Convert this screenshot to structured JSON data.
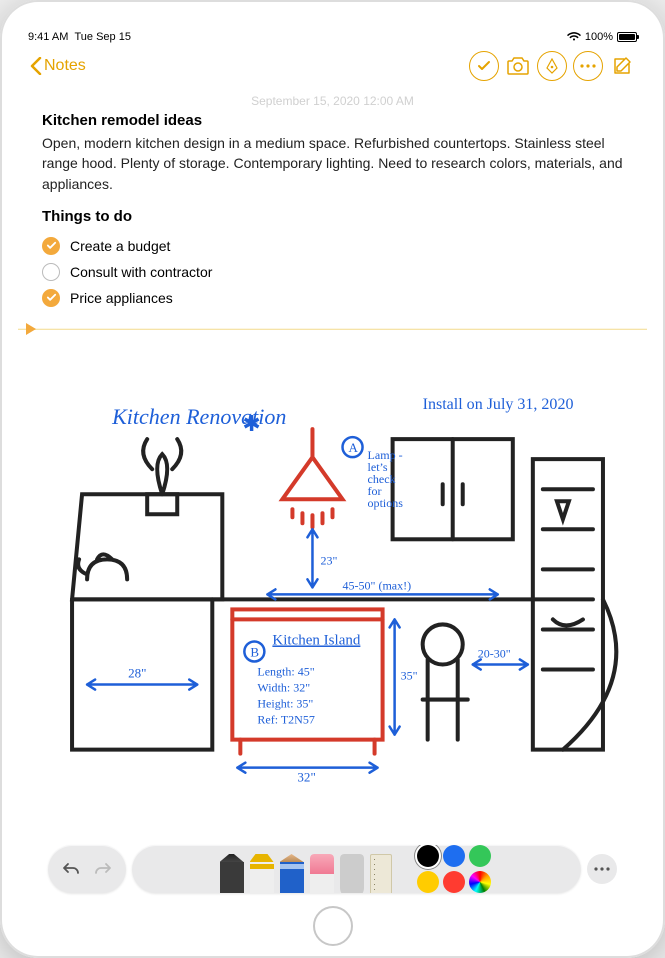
{
  "status": {
    "time": "9:41 AM",
    "date": "Tue Sep 15",
    "battery": "100%"
  },
  "nav": {
    "back_label": "Notes"
  },
  "note": {
    "timestamp": "September 15, 2020 12:00 AM",
    "title": "Kitchen remodel ideas",
    "body": "Open, modern kitchen design in a medium space. Refurbished countertops. Stainless steel range hood. Plenty of storage. Contemporary lighting. Need to research colors, materials, and appliances.",
    "section_title": "Things to do",
    "checklist": [
      {
        "label": "Create a budget",
        "checked": true
      },
      {
        "label": "Consult with contractor",
        "checked": false
      },
      {
        "label": "Price appliances",
        "checked": true
      }
    ]
  },
  "sketch": {
    "title": "Kitchen Renovation",
    "install_note": "Install on July 31, 2020",
    "annotation_a": "Lamp - let’s check for options",
    "island_heading": "Kitchen Island",
    "island_spec_length": "Length: 45\"",
    "island_spec_width": "Width: 32\"",
    "island_spec_height": "Height: 35\"",
    "island_spec_ref": "Ref: T2N57",
    "dim_left": "28\"",
    "dim_lamp_clear": "23\"",
    "dim_width_range": "45-50\" (max!)",
    "dim_right": "20-30\"",
    "dim_island_width": "32\"",
    "dim_island_height": "35\""
  },
  "colors": {
    "accent": "#e5a300",
    "swatch_black": "#000000",
    "swatch_blue": "#1e6ef0",
    "swatch_green": "#34c759",
    "swatch_yellow": "#ffcc00",
    "swatch_red": "#ff3b30"
  }
}
